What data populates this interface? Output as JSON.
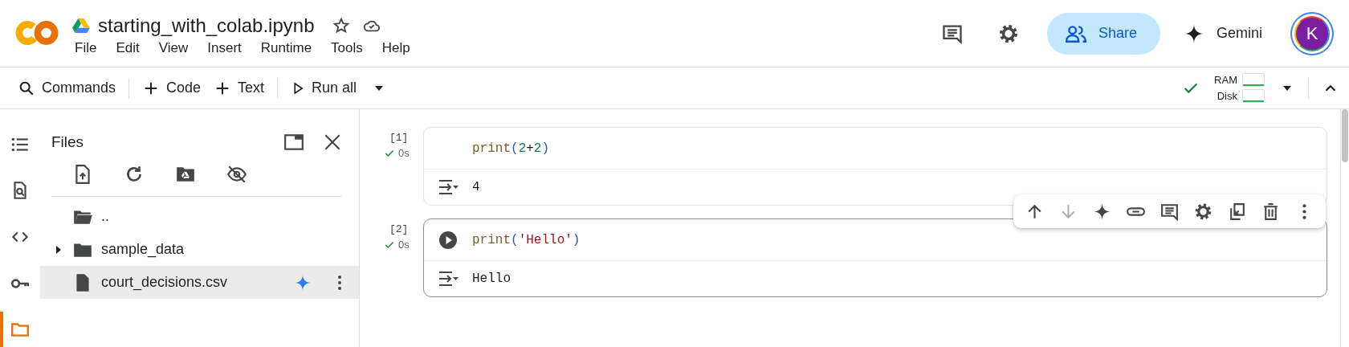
{
  "notebook_title": "starting_with_colab.ipynb",
  "starred": false,
  "menu": [
    "File",
    "Edit",
    "View",
    "Insert",
    "Runtime",
    "Tools",
    "Help"
  ],
  "header_actions": {
    "share": "Share",
    "gemini": "Gemini",
    "avatar": "K"
  },
  "toolbar": {
    "commands": "Commands",
    "add_code": "Code",
    "add_text": "Text",
    "run_all": "Run all"
  },
  "runtime": {
    "connected": true,
    "resources": [
      {
        "label": "RAM"
      },
      {
        "label": "Disk"
      }
    ]
  },
  "rail": [
    {
      "kind": "toc",
      "selected": false
    },
    {
      "kind": "find",
      "selected": false
    },
    {
      "kind": "snippets",
      "selected": false
    },
    {
      "kind": "secrets",
      "selected": false
    },
    {
      "kind": "files",
      "selected": true
    }
  ],
  "files_panel": {
    "title": "Files",
    "tree": [
      {
        "kind": "parent",
        "name": "..",
        "selected": false
      },
      {
        "kind": "folder",
        "name": "sample_data",
        "expanded": false,
        "selected": false
      },
      {
        "kind": "file",
        "name": "court_decisions.csv",
        "selected": true
      }
    ]
  },
  "cells": [
    {
      "execution_count": "[1]",
      "duration": "0s",
      "succeeded": true,
      "selected": false,
      "output": "4",
      "code": [
        {
          "kind": "func",
          "text": "print"
        },
        {
          "kind": "paren",
          "text": "("
        },
        {
          "kind": "number",
          "text": "2"
        },
        {
          "kind": "op",
          "text": "+"
        },
        {
          "kind": "number",
          "text": "2"
        },
        {
          "kind": "paren",
          "text": ")"
        }
      ]
    },
    {
      "execution_count": "[2]",
      "duration": "0s",
      "succeeded": true,
      "selected": true,
      "output": "Hello",
      "code": [
        {
          "kind": "func",
          "text": "print"
        },
        {
          "kind": "paren",
          "text": "("
        },
        {
          "kind": "string",
          "text": "'Hello'"
        },
        {
          "kind": "paren",
          "text": ")"
        }
      ]
    }
  ],
  "cell_toolbar": [
    {
      "kind": "up",
      "disabled": false
    },
    {
      "kind": "down",
      "disabled": true
    },
    {
      "kind": "gemini",
      "disabled": false
    },
    {
      "kind": "link",
      "disabled": false
    },
    {
      "kind": "comment",
      "disabled": false
    },
    {
      "kind": "settings",
      "disabled": false
    },
    {
      "kind": "mirror",
      "disabled": false
    },
    {
      "kind": "delete",
      "disabled": false
    },
    {
      "kind": "more",
      "disabled": false
    }
  ]
}
